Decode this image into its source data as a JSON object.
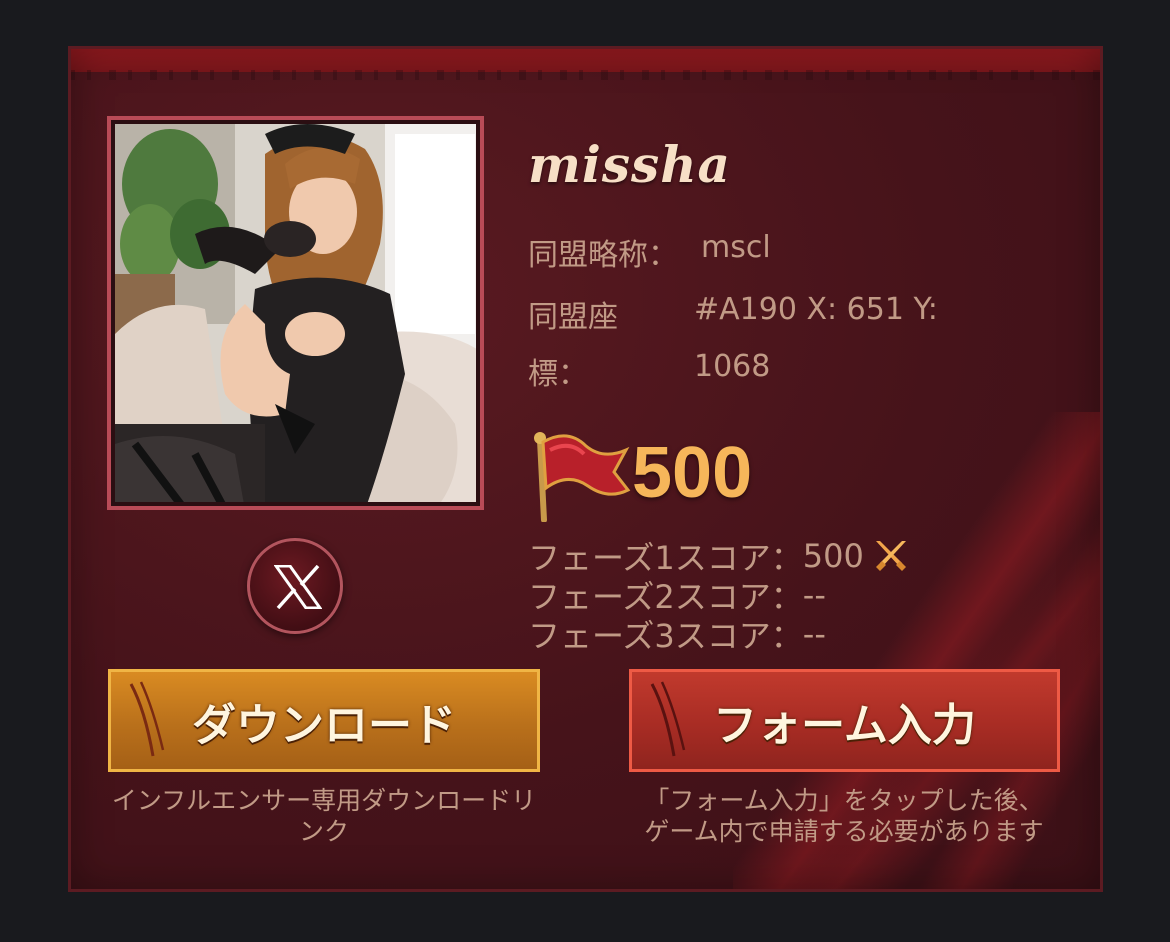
{
  "profile": {
    "name": "missha",
    "alliance_abbr_label": "同盟略称：",
    "alliance_abbr_value": "mscl",
    "coords_label_line1": "同盟座",
    "coords_label_line2": "標：",
    "coords_value_line1": "#A190 X: 651 Y:",
    "coords_value_line2": "1068",
    "x_link_icon": "x-logo-icon"
  },
  "score": {
    "icon": "red-flag-icon",
    "total": "500",
    "phases": [
      {
        "label": "フェーズ1スコア：",
        "value": "500",
        "icon": "crossed-swords-icon"
      },
      {
        "label": "フェーズ2スコア：",
        "value": "--"
      },
      {
        "label": "フェーズ3スコア：",
        "value": "--"
      }
    ]
  },
  "actions": {
    "download_label": "ダウンロード",
    "download_caption_line1": "インフルエンサー専用ダウンロードリ",
    "download_caption_line2": "ンク",
    "form_label": "フォーム入力",
    "form_caption_line1": "「フォーム入力」をタップした後、",
    "form_caption_line2": "ゲーム内で申請する必要があります"
  },
  "colors": {
    "background": "#191a1e",
    "card": "#46131a",
    "accent_gold": "#f6b65a",
    "text_muted": "#c19a86",
    "download_button": "#c07a1e",
    "form_button": "#b0302a"
  }
}
